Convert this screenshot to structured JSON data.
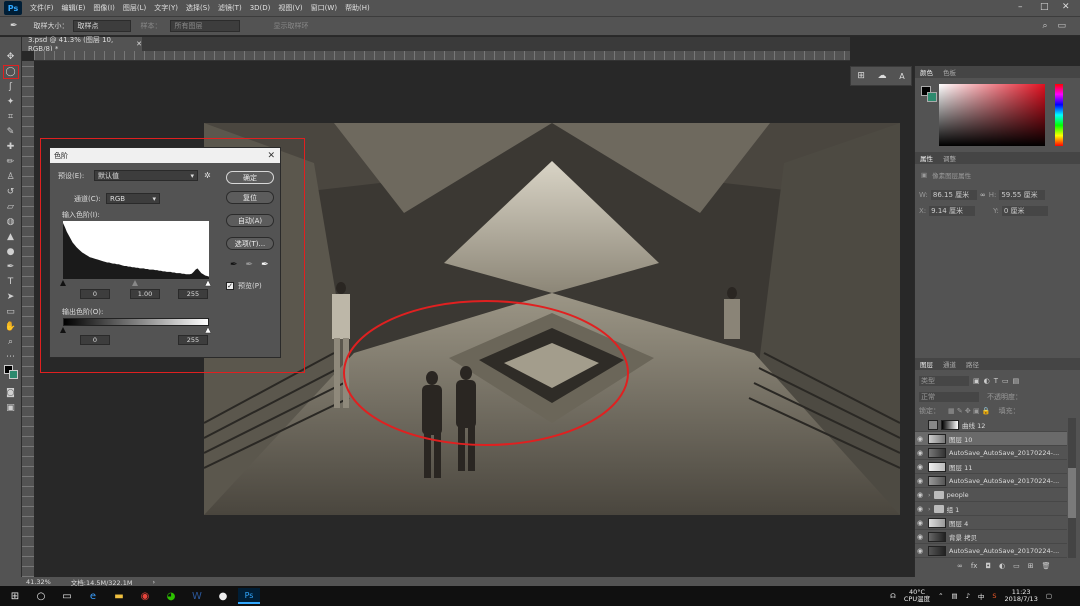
{
  "app": {
    "logo": "Ps",
    "menus": [
      "文件(F)",
      "编辑(E)",
      "图像(I)",
      "图层(L)",
      "文字(Y)",
      "选择(S)",
      "滤镜(T)",
      "3D(D)",
      "视图(V)",
      "窗口(W)",
      "帮助(H)"
    ]
  },
  "options_bar": {
    "sample_size_label": "取样大小：",
    "sample_size_value": "取样点",
    "sample_label": "样本：",
    "sample_value": "所有图层",
    "show_ring": "显示取样环"
  },
  "document": {
    "tab_title": "3.psd @ 41.3% (图层 10, RGB/8) *",
    "zoom": "41.32%",
    "doc_size": "文档:14.5M/322.1M"
  },
  "levels_dialog": {
    "title": "色阶",
    "preset_label": "预设(E):",
    "preset_value": "默认值",
    "channel_label": "通道(C):",
    "channel_value": "RGB",
    "input_label": "输入色阶(I):",
    "input_black": "0",
    "input_gamma": "1.00",
    "input_white": "255",
    "output_label": "输出色阶(O):",
    "output_black": "0",
    "output_white": "255",
    "buttons": {
      "ok": "确定",
      "reset": "复位",
      "auto": "自动(A)",
      "options": "选项(T)..."
    },
    "preview_label": "预览(P)",
    "preview_checked": true,
    "histogram": [
      95,
      88,
      80,
      74,
      68,
      62,
      58,
      54,
      51,
      48,
      45,
      43,
      41,
      39,
      37,
      36,
      35,
      34,
      33,
      32,
      31,
      30,
      29,
      28,
      28,
      27,
      26,
      26,
      25,
      25,
      24,
      23,
      22,
      22,
      21,
      21,
      20,
      20,
      19,
      19,
      18,
      18,
      18,
      17,
      17,
      16,
      16,
      16,
      15,
      15,
      14,
      14,
      13,
      13,
      12,
      12,
      12,
      11,
      11,
      10,
      10,
      10,
      9,
      9,
      8,
      8,
      8,
      9,
      12,
      16,
      18,
      14,
      10,
      8,
      6,
      5,
      4
    ]
  },
  "right_panel": {
    "color_tabs": [
      "颜色",
      "色板"
    ],
    "props_tabs": [
      "属性",
      "调整"
    ],
    "props_title": "像素图层属性",
    "width_label": "W:",
    "width_value": "86.15 厘米",
    "height_label": "H:",
    "height_value": "59.55 厘米",
    "x_label": "X:",
    "x_value": "9.14 厘米",
    "y_label": "Y:",
    "y_value": "0 厘米",
    "layers_tabs": [
      "图层",
      "通道",
      "路径"
    ],
    "layer_kind": "类型",
    "blend_mode": "正常",
    "opacity_label": "不透明度：",
    "lock_label": "锁定：",
    "fill_label": "填充：",
    "layers": [
      {
        "name": "曲线 12",
        "type": "adjust"
      },
      {
        "name": "图层 10",
        "type": "pixel",
        "selected": true
      },
      {
        "name": "AutoSave_AutoSave_20170224-...",
        "type": "pixel"
      },
      {
        "name": "图层 11",
        "type": "pixel"
      },
      {
        "name": "AutoSave_AutoSave_20170224-...",
        "type": "pixel"
      },
      {
        "name": "people",
        "type": "group"
      },
      {
        "name": "组 1",
        "type": "group"
      },
      {
        "name": "图层 4",
        "type": "pixel"
      },
      {
        "name": "背景 拷贝",
        "type": "pixel"
      },
      {
        "name": "AutoSave_AutoSave_20170224-...",
        "type": "pixel"
      }
    ]
  },
  "taskbar": {
    "temperature": "40°C",
    "cpu_label": "CPU温度",
    "ime": "中",
    "time": "11:23",
    "date": "2018/7/13"
  },
  "colors": {
    "accent_red": "#e02020",
    "panel_bg": "#535353",
    "canvas_bg": "#282828"
  }
}
